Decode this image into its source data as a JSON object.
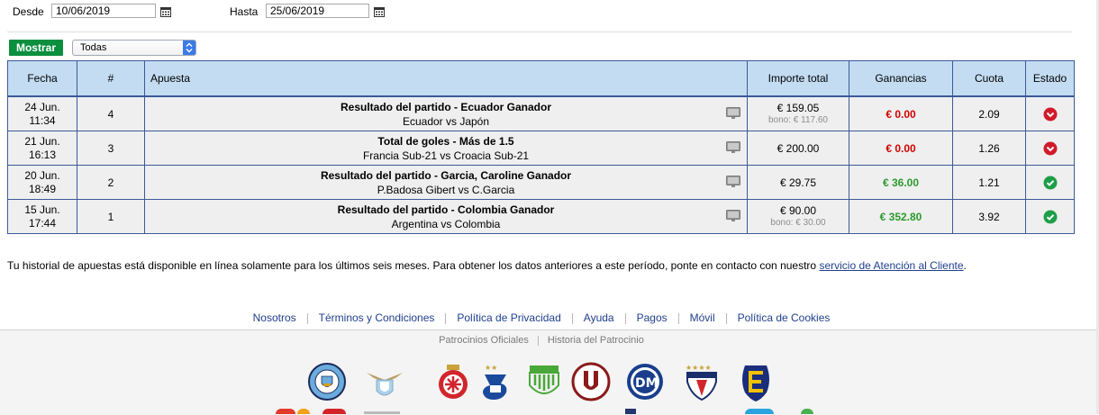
{
  "filters": {
    "from_label": "Desde",
    "from_value": "10/06/2019",
    "to_label": "Hasta",
    "to_value": "25/06/2019",
    "show_label": "Mostrar",
    "type_selected": "Todas"
  },
  "table": {
    "headers": {
      "date": "Fecha",
      "number": "#",
      "bet": "Apuesta",
      "total": "Importe total",
      "winnings": "Ganancias",
      "odds": "Cuota",
      "status": "Estado"
    },
    "rows": [
      {
        "day": "24 Jun.",
        "time": "11:34",
        "number": "4",
        "title": "Resultado del partido - Ecuador Ganador",
        "match": "Ecuador vs Japón",
        "amount": "€ 159.05",
        "bonus": "bono: € 117.60",
        "winnings": "€ 0.00",
        "odds": "2.09",
        "status": "lost"
      },
      {
        "day": "21 Jun.",
        "time": "16:13",
        "number": "3",
        "title": "Total de goles - Más de 1.5",
        "match": "Francia Sub-21 vs Croacia Sub-21",
        "amount": "€ 200.00",
        "bonus": "",
        "winnings": "€ 0.00",
        "odds": "1.26",
        "status": "lost"
      },
      {
        "day": "20 Jun.",
        "time": "18:49",
        "number": "2",
        "title": "Resultado del partido - Garcia, Caroline Ganador",
        "match": "P.Badosa Gibert vs C.Garcia",
        "amount": "€ 29.75",
        "bonus": "",
        "winnings": "€ 36.00",
        "odds": "1.21",
        "status": "won"
      },
      {
        "day": "15 Jun.",
        "time": "17:44",
        "number": "1",
        "title": "Resultado del partido - Colombia Ganador",
        "match": "Argentina vs Colombia",
        "amount": "€ 90.00",
        "bonus": "bono: € 30.00",
        "winnings": "€ 352.80",
        "odds": "3.92",
        "status": "won"
      }
    ]
  },
  "note": {
    "text": "Tu historial de apuestas está disponible en línea solamente para los últimos seis meses. Para obtener los datos anteriores a este período, ponte en contacto con nuestro ",
    "link": "servicio de Atención al Cliente",
    "end": "."
  },
  "footer": {
    "links": [
      "Nosotros",
      "Términos y Condiciones",
      "Política de Privacidad",
      "Ayuda",
      "Pagos",
      "Móvil",
      "Política de Cookies"
    ],
    "sponsor_links": [
      "Patrocinios Oficiales",
      "Historia del Patrocinio"
    ],
    "club_logos": [
      "manchester-city",
      "lazio",
      "girona",
      "dinamo",
      "club-logo-5",
      "universitario",
      "deportivo-municipal",
      "ldu-quito",
      "everton-chile"
    ]
  },
  "colors": {
    "header_bg": "#c3dcf2",
    "border": "#3a5a98",
    "loss": "#d40000",
    "win": "#2b9a2b",
    "button": "#0a8f3f",
    "link": "#1f3f8c"
  }
}
